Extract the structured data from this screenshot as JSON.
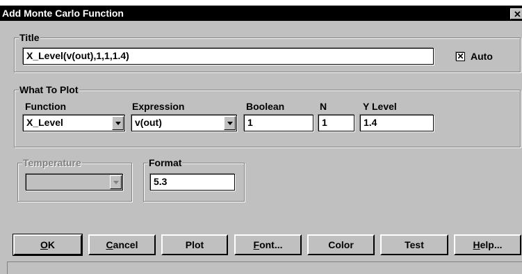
{
  "window": {
    "title": "Add Monte Carlo Function",
    "close_glyph": "✕"
  },
  "title_group": {
    "legend": "Title",
    "value": "X_Level(v(out),1,1,1.4)",
    "auto_label": "Auto",
    "auto_checked": true,
    "check_glyph": "✕"
  },
  "plot_group": {
    "legend": "What To Plot",
    "function_label": "Function",
    "function_value": "X_Level",
    "expression_label": "Expression",
    "expression_value": "v(out)",
    "boolean_label": "Boolean",
    "boolean_value": "1",
    "n_label": "N",
    "n_value": "1",
    "ylevel_label": "Y Level",
    "ylevel_value": "1.4"
  },
  "temperature_group": {
    "legend": "Temperature",
    "value": "",
    "enabled": false
  },
  "format_group": {
    "legend": "Format",
    "value": "5.3"
  },
  "buttons": {
    "ok": {
      "mnemonic": "O",
      "rest": "K"
    },
    "cancel": {
      "mnemonic": "C",
      "rest": "ancel"
    },
    "plot": {
      "label": "Plot"
    },
    "font": {
      "mnemonic": "F",
      "rest": "ont..."
    },
    "color": {
      "label": "Color"
    },
    "test": {
      "label": "Test"
    },
    "help": {
      "mnemonic": "H",
      "rest": "elp..."
    }
  },
  "status_text": ""
}
